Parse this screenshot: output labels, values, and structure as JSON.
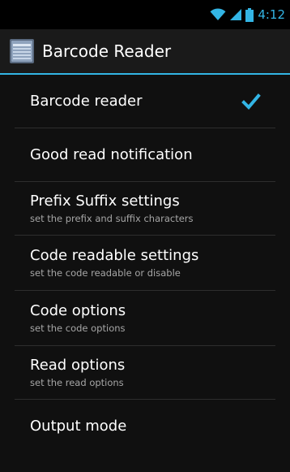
{
  "status_bar": {
    "time": "4:12",
    "icons": [
      "wifi-icon",
      "signal-icon",
      "battery-icon"
    ],
    "accent_color": "#33b5e5"
  },
  "action_bar": {
    "title": "Barcode Reader",
    "icon": "barcode-app-icon"
  },
  "preferences": [
    {
      "title": "Barcode reader",
      "summary": "",
      "checked": true
    },
    {
      "title": "Good read notification",
      "summary": ""
    },
    {
      "title": "Prefix Suffix settings",
      "summary": "set the prefix and suffix characters"
    },
    {
      "title": "Code readable settings",
      "summary": "set the code readable or disable"
    },
    {
      "title": "Code options",
      "summary": "set the code options"
    },
    {
      "title": "Read options",
      "summary": "set the read options"
    },
    {
      "title": "Output mode",
      "summary": ""
    }
  ],
  "colors": {
    "accent": "#33b5e5",
    "background": "#101010",
    "text_primary": "#ffffff",
    "text_secondary": "#a6a6a6"
  }
}
